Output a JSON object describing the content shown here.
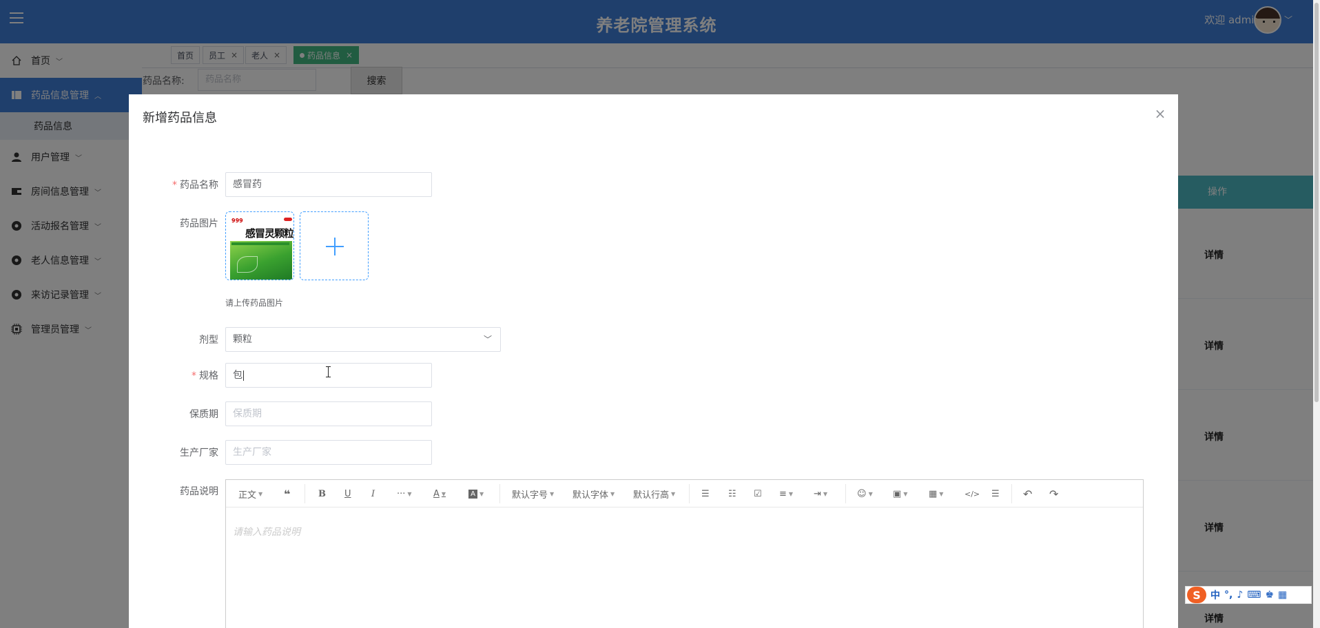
{
  "header": {
    "title": "养老院管理系统",
    "welcome": "欢迎 admin"
  },
  "sidebar": {
    "items": [
      {
        "label": "首页",
        "icon": "home-icon"
      },
      {
        "label": "药品信息管理",
        "icon": "list-icon"
      },
      {
        "label": "用户管理",
        "icon": "user-icon"
      },
      {
        "label": "房间信息管理",
        "icon": "wallet-icon"
      },
      {
        "label": "活动报名管理",
        "icon": "circle-icon"
      },
      {
        "label": "老人信息管理",
        "icon": "circle-icon"
      },
      {
        "label": "来访记录管理",
        "icon": "circle-icon"
      },
      {
        "label": "管理员管理",
        "icon": "chip-icon"
      }
    ],
    "subitem": "药品信息"
  },
  "tabs": [
    {
      "label": "首页"
    },
    {
      "label": "员工"
    },
    {
      "label": "老人"
    },
    {
      "label": "药品信息"
    }
  ],
  "filter": {
    "label": "药品名称:",
    "placeholder": "药品名称",
    "search_label": "搜索"
  },
  "table": {
    "op_header": "操作",
    "rows": [
      "详情",
      "详情",
      "详情",
      "详情",
      "详情"
    ]
  },
  "dialog": {
    "title": "新增药品信息",
    "close": "×",
    "fields": {
      "name_label": "药品名称",
      "name_value": "感冒药",
      "image_label": "药品图片",
      "image_tip": "请上传药品图片",
      "product_text": "感冒灵颗粒",
      "product_brand": "999",
      "form_label": "剂型",
      "form_value": "颗粒",
      "spec_label": "规格",
      "spec_value": "包",
      "shelf_label": "保质期",
      "shelf_placeholder": "保质期",
      "maker_label": "生产厂家",
      "maker_placeholder": "生产厂家",
      "desc_label": "药品说明",
      "desc_placeholder": "请输入药品说明"
    },
    "toolbar": {
      "heading": "正文",
      "font_size": "默认字号",
      "font_family": "默认字体",
      "line_height": "默认行高"
    }
  },
  "ime": {
    "mode": "中"
  }
}
